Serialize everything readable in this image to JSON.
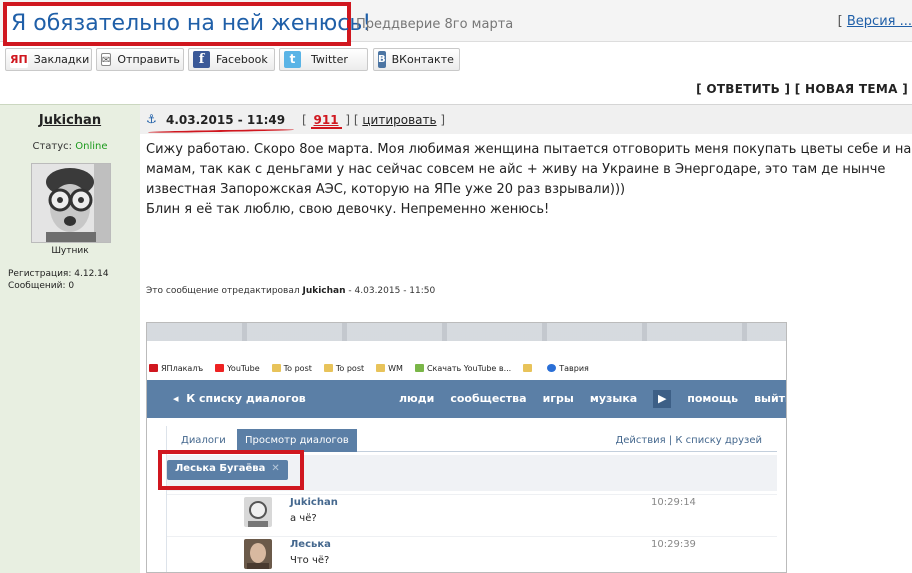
{
  "header": {
    "title": "Я обязательно на ней женюсь!",
    "subtitle": "Преддверие 8го марта",
    "version_prefix": "[",
    "version_link": "Версия ..."
  },
  "share": [
    {
      "label": "Закладки",
      "icon": "yap-icon"
    },
    {
      "label": "Отправить",
      "icon": "mail-icon"
    },
    {
      "label": "Facebook",
      "icon": "facebook-icon"
    },
    {
      "label": "Twitter",
      "icon": "twitter-icon"
    },
    {
      "label": "ВКонтакте",
      "icon": "vk-icon"
    }
  ],
  "actions": {
    "reply": "[ ОТВЕТИТЬ ]",
    "new_topic": "[ НОВАЯ ТЕМА ]"
  },
  "post": {
    "author": "Jukichan",
    "date": "4.03.2015 - 11:49",
    "number": "911",
    "cite": "цитировать",
    "status_label": "Статус:",
    "status_value": "Online",
    "avatar_label": "Шутник",
    "reg_label": "Регистрация:",
    "reg_value": "4.12.14",
    "posts_label": "Сообщений:",
    "posts_value": "0",
    "body": [
      "Сижу работаю. Скоро 8ое марта. Моя любимая женщина пытается отговорить меня покупать цветы себе и наши",
      "мамам, так как с деньгами у нас сейчас совсем не айс + живу на Украине в Энергодаре, это там де нынче",
      "известная Запорожская АЭС, которую на ЯПе уже 20 раз взрывали)))",
      "Блин я её так люблю, свою девочку. Непременно женюсь!"
    ],
    "edited_prefix": "Это сообщение отредактировал",
    "edited_author": "Jukichan",
    "edited_suffix": "- 4.03.2015 - 11:50"
  },
  "screenshot": {
    "bookmarks": [
      "ЯПлакалъ",
      "YouTube",
      "To post",
      "To post",
      "WM",
      "Скачать YouTube в...",
      "",
      "Таврия"
    ],
    "nav_back": "К списку диалогов",
    "nav_items": [
      "люди",
      "сообщества",
      "игры",
      "музыка",
      "помощь",
      "выйти"
    ],
    "tab_dialogs": "Диалоги",
    "tab_view": "Просмотр диалогов",
    "tab_right": "Действия  |  К списку друзей",
    "chip": "Леська Бугаёва",
    "messages": [
      {
        "name": "Jukichan",
        "text": "а чё?",
        "time": "10:29:14"
      },
      {
        "name": "Леська",
        "text": "Что чё?",
        "time": "10:29:39"
      }
    ]
  },
  "colors": {
    "accent_red": "#d0171f",
    "link_blue": "#1f5fa8",
    "vk_blue": "#5b7fa6",
    "sidebar_green": "#e8efe1",
    "online_green": "#1d9a1d"
  }
}
